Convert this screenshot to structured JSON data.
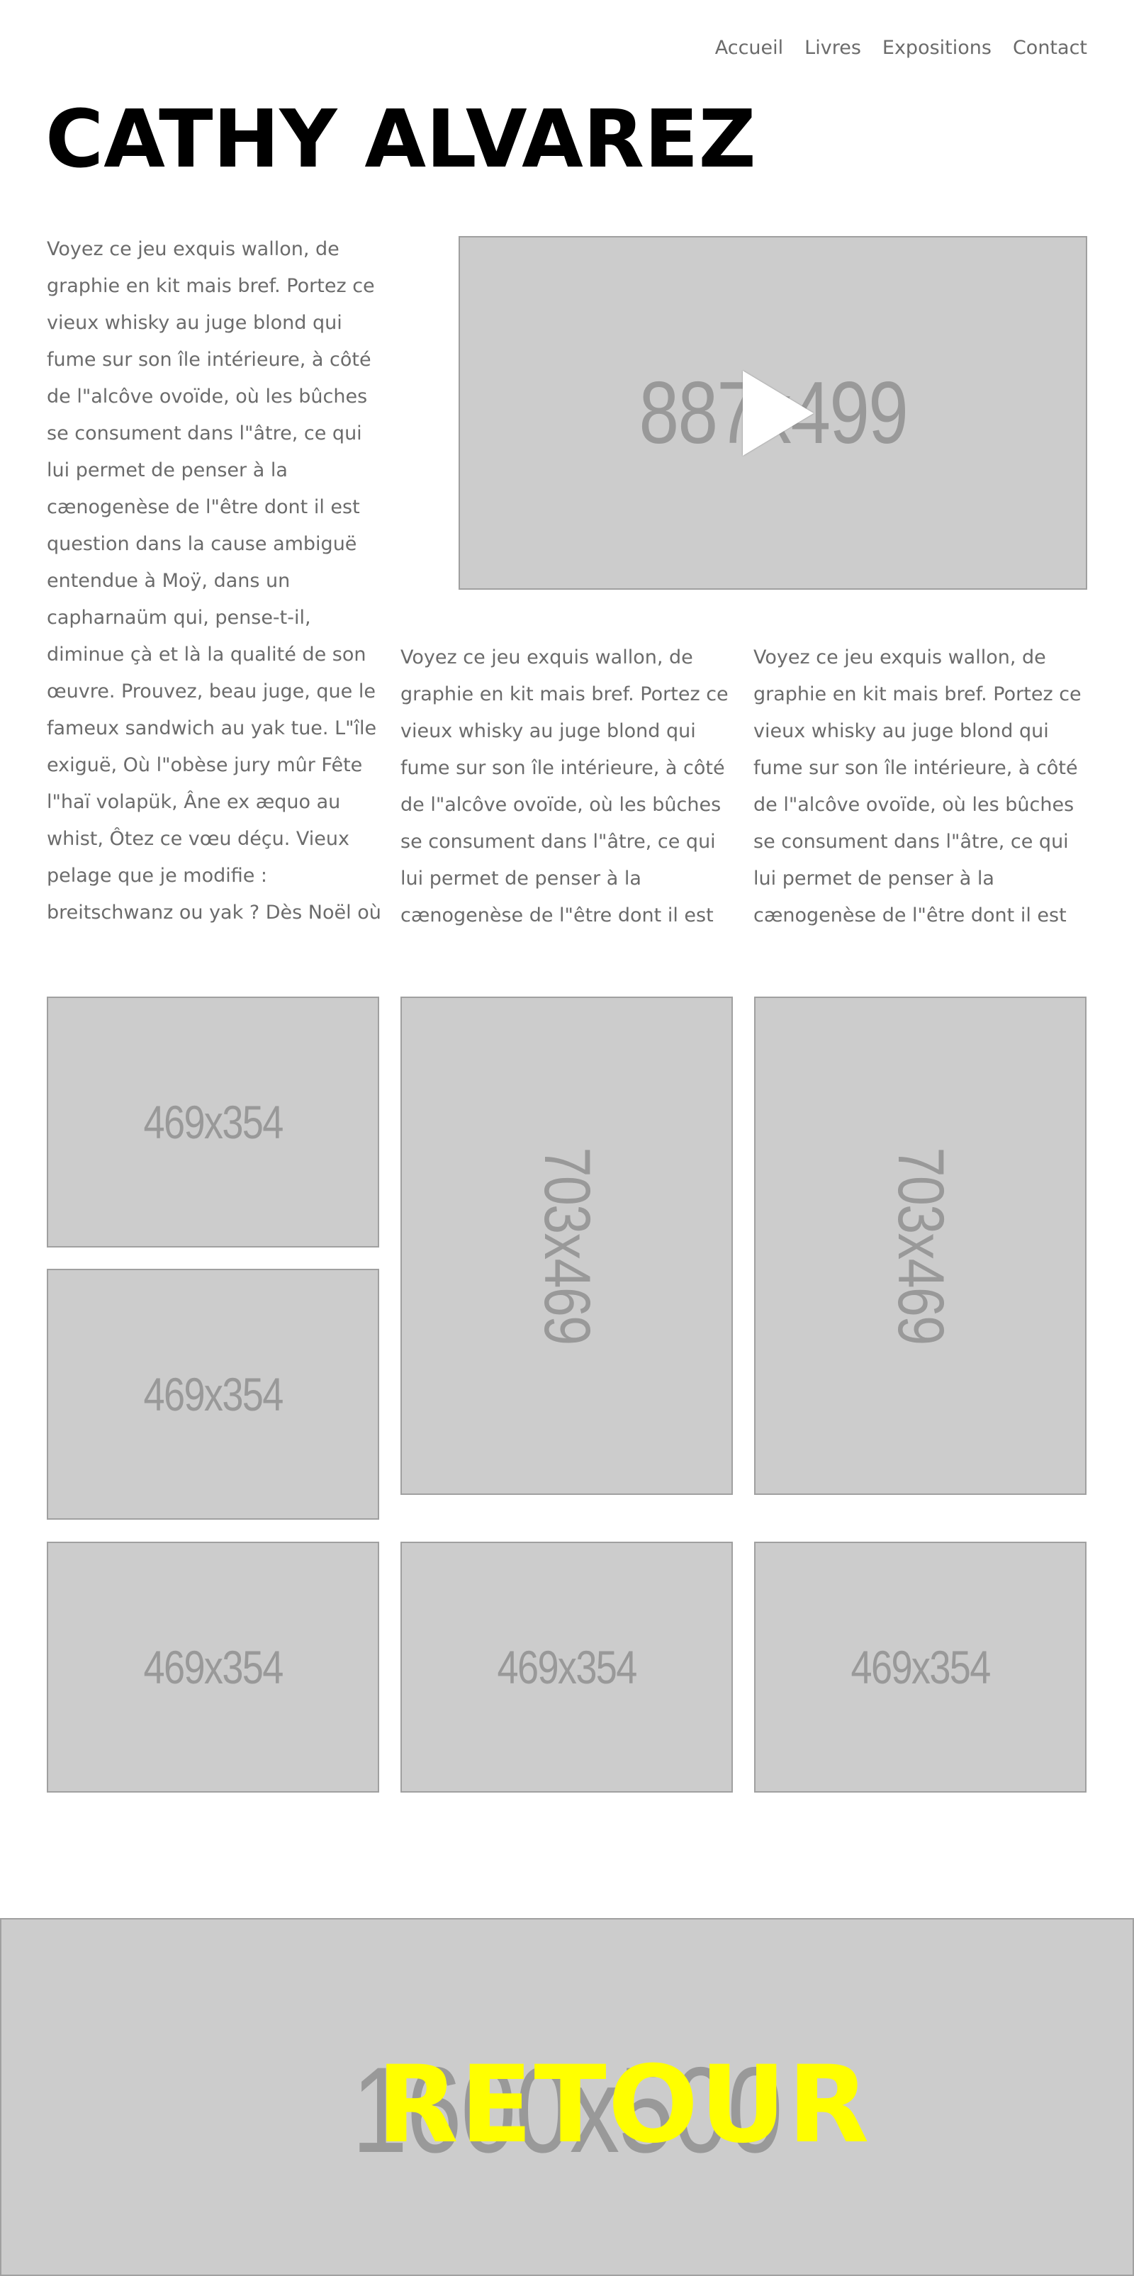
{
  "nav": {
    "items": [
      "Accueil",
      "Livres",
      "Expositions",
      "Contact"
    ]
  },
  "header": {
    "title": "CATHY ALVAREZ"
  },
  "content": {
    "text_left": "Voyez ce jeu exquis wallon, de graphie en kit mais bref. Portez ce vieux whisky au juge blond qui fume sur son île intérieure, à côté de l\"alcôve ovoïde, où les bûches se consument dans l\"âtre, ce qui lui permet de penser à la cænogenèse de l\"être dont il est question dans la cause ambiguë entendue à Moÿ, dans un capharnaüm qui, pense-t-il, diminue çà et là la qualité de son œuvre. Prouvez, beau juge, que le fameux sandwich au yak tue. L\"île exiguë, Où l\"obèse jury mûr Fête l\"haï volapük, Âne ex æquo au whist, Ôtez ce vœu déçu. Vieux pelage que je modifie : breitschwanz ou yak ? Dès Noël où un zéphyr haï",
    "text_mid": "Voyez ce jeu exquis wallon, de graphie en kit mais bref. Portez ce vieux whisky au juge blond qui fume sur son île intérieure, à côté de l\"alcôve ovoïde, où les bûches se consument dans l\"âtre, ce qui lui permet de penser à la cænogenèse de l\"être dont il est",
    "text_right": "Voyez ce jeu exquis wallon, de graphie en kit mais bref. Portez ce vieux whisky au juge blond qui fume sur son île intérieure, à côté de l\"alcôve ovoïde, où les bûches se consument dans l\"âtre, ce qui lui permet de penser à la cænogenèse de l\"être dont il est",
    "video_label": "887x499"
  },
  "gallery": {
    "items": [
      "469x354",
      "469x354",
      "703x469",
      "703x469",
      "469x354",
      "469x354",
      "469x354"
    ]
  },
  "footer": {
    "banner_label": "1600x500",
    "retour_label": "RETOUR",
    "retour_color": "#ffff00"
  },
  "colors": {
    "placeholder_bg": "#cccccc",
    "placeholder_text": "#999999",
    "title": "#000000",
    "body_text": "#6b6b6b"
  }
}
